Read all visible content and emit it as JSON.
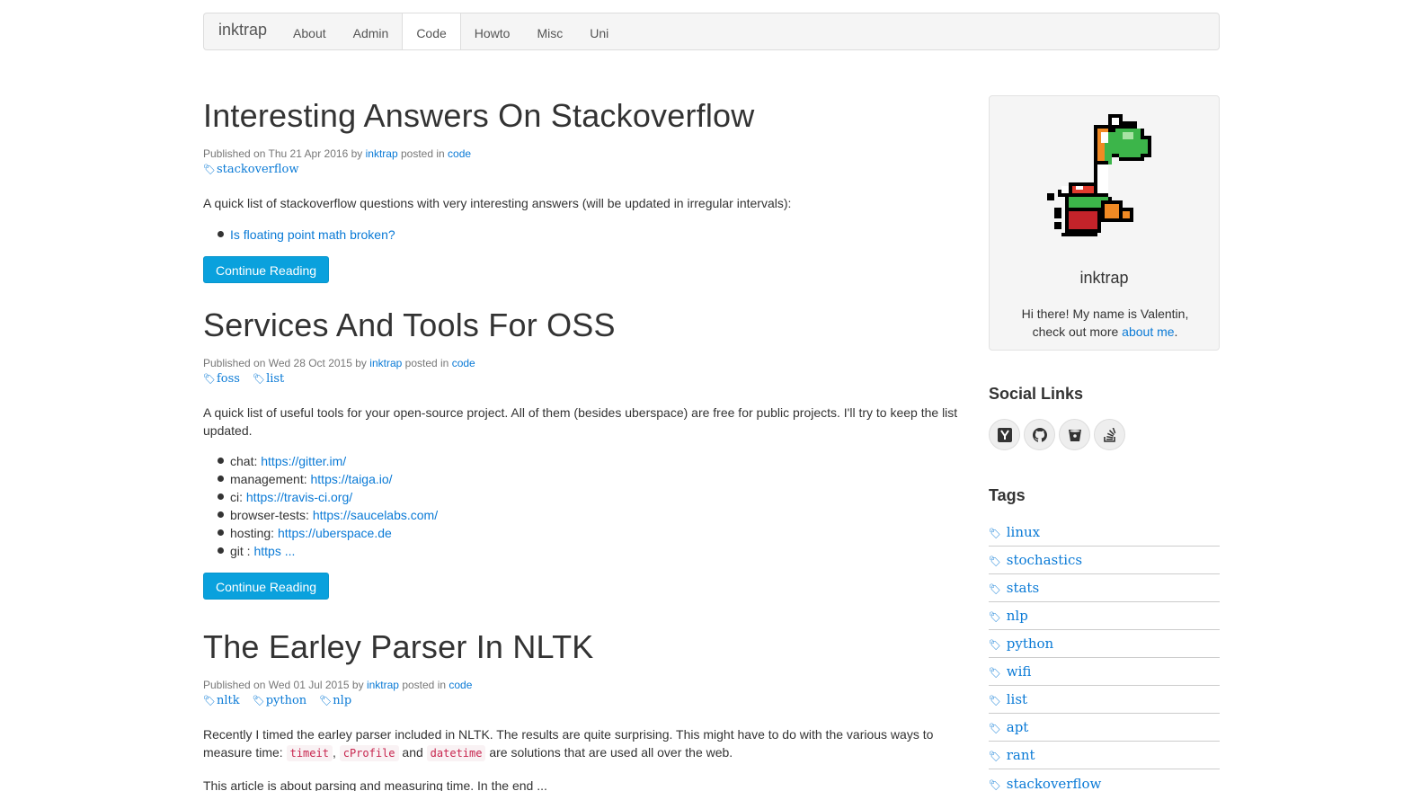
{
  "navbar": {
    "brand": "inktrap",
    "items": [
      {
        "label": "About"
      },
      {
        "label": "Admin"
      },
      {
        "label": "Code"
      },
      {
        "label": "Howto"
      },
      {
        "label": "Misc"
      },
      {
        "label": "Uni"
      }
    ],
    "active": "Code"
  },
  "posts": [
    {
      "title": "Interesting Answers On Stackoverflow",
      "published_prefix": "Published on",
      "date": "Thu 21 Apr 2016",
      "by": "by",
      "author": "inktrap",
      "posted_in": "posted in",
      "category": "code",
      "tags": [
        "stackoverflow"
      ],
      "summary": "A quick list of stackoverflow questions with very interesting answers (will be updated in irregular intervals):",
      "links": [
        {
          "text": "Is floating point math broken?"
        }
      ],
      "button": "Continue Reading"
    },
    {
      "title": "Services And Tools For OSS",
      "published_prefix": "Published on",
      "date": "Wed 28 Oct 2015",
      "by": "by",
      "author": "inktrap",
      "posted_in": "posted in",
      "category": "code",
      "tags": [
        "foss",
        "list"
      ],
      "summary": "A quick list of useful tools for your open-source project. All of them (besides uberspace) are free for public projects. I'll try to keep the list updated.",
      "items": [
        {
          "label": "chat:",
          "link": "https://gitter.im/"
        },
        {
          "label": "management:",
          "link": "https://taiga.io/"
        },
        {
          "label": "ci:",
          "link": "https://travis-ci.org/"
        },
        {
          "label": "browser-tests:",
          "link": "https://saucelabs.com/"
        },
        {
          "label": "hosting:",
          "link": "https://uberspace.de"
        },
        {
          "label": "git :",
          "link": "https ..."
        }
      ],
      "button": "Continue Reading"
    },
    {
      "title": "The Earley Parser In NLTK",
      "published_prefix": "Published on",
      "date": "Wed 01 Jul 2015",
      "by": "by",
      "author": "inktrap",
      "posted_in": "posted in",
      "category": "code",
      "tags": [
        "nltk",
        "python",
        "nlp"
      ],
      "summary_start": "Recently I timed the earley parser included in NLTK. The results are quite surprising. This might have to do with the various ways to measure time:",
      "code1": "timeit",
      "sep1": ",",
      "code2": "cProfile",
      "sep2": "and",
      "code3": "datetime",
      "summary_end": "are solutions that are used all over the web.",
      "summary2": "This article is about parsing and measuring time. In the end ..."
    }
  ],
  "sidebar": {
    "profile": {
      "name": "inktrap",
      "bio_start": "Hi there! My name is Valentin, check out more",
      "bio_link": "about me",
      "bio_end": "."
    },
    "social_heading": "Social Links",
    "social_links": [
      {
        "icon": "hacker-news-icon"
      },
      {
        "icon": "github-icon"
      },
      {
        "icon": "bitbucket-icon"
      },
      {
        "icon": "stackoverflow-icon"
      }
    ],
    "tags_heading": "Tags",
    "tags": [
      "linux",
      "stochastics",
      "stats",
      "nlp",
      "python",
      "wifi",
      "list",
      "apt",
      "rant",
      "stackoverflow"
    ]
  },
  "colors": {
    "link": "#0a7ad6",
    "button": "#0aa1dd",
    "code_text": "#c7254e",
    "code_bg": "#f9f2f4",
    "navbar_bg": "#f5f5f5"
  }
}
